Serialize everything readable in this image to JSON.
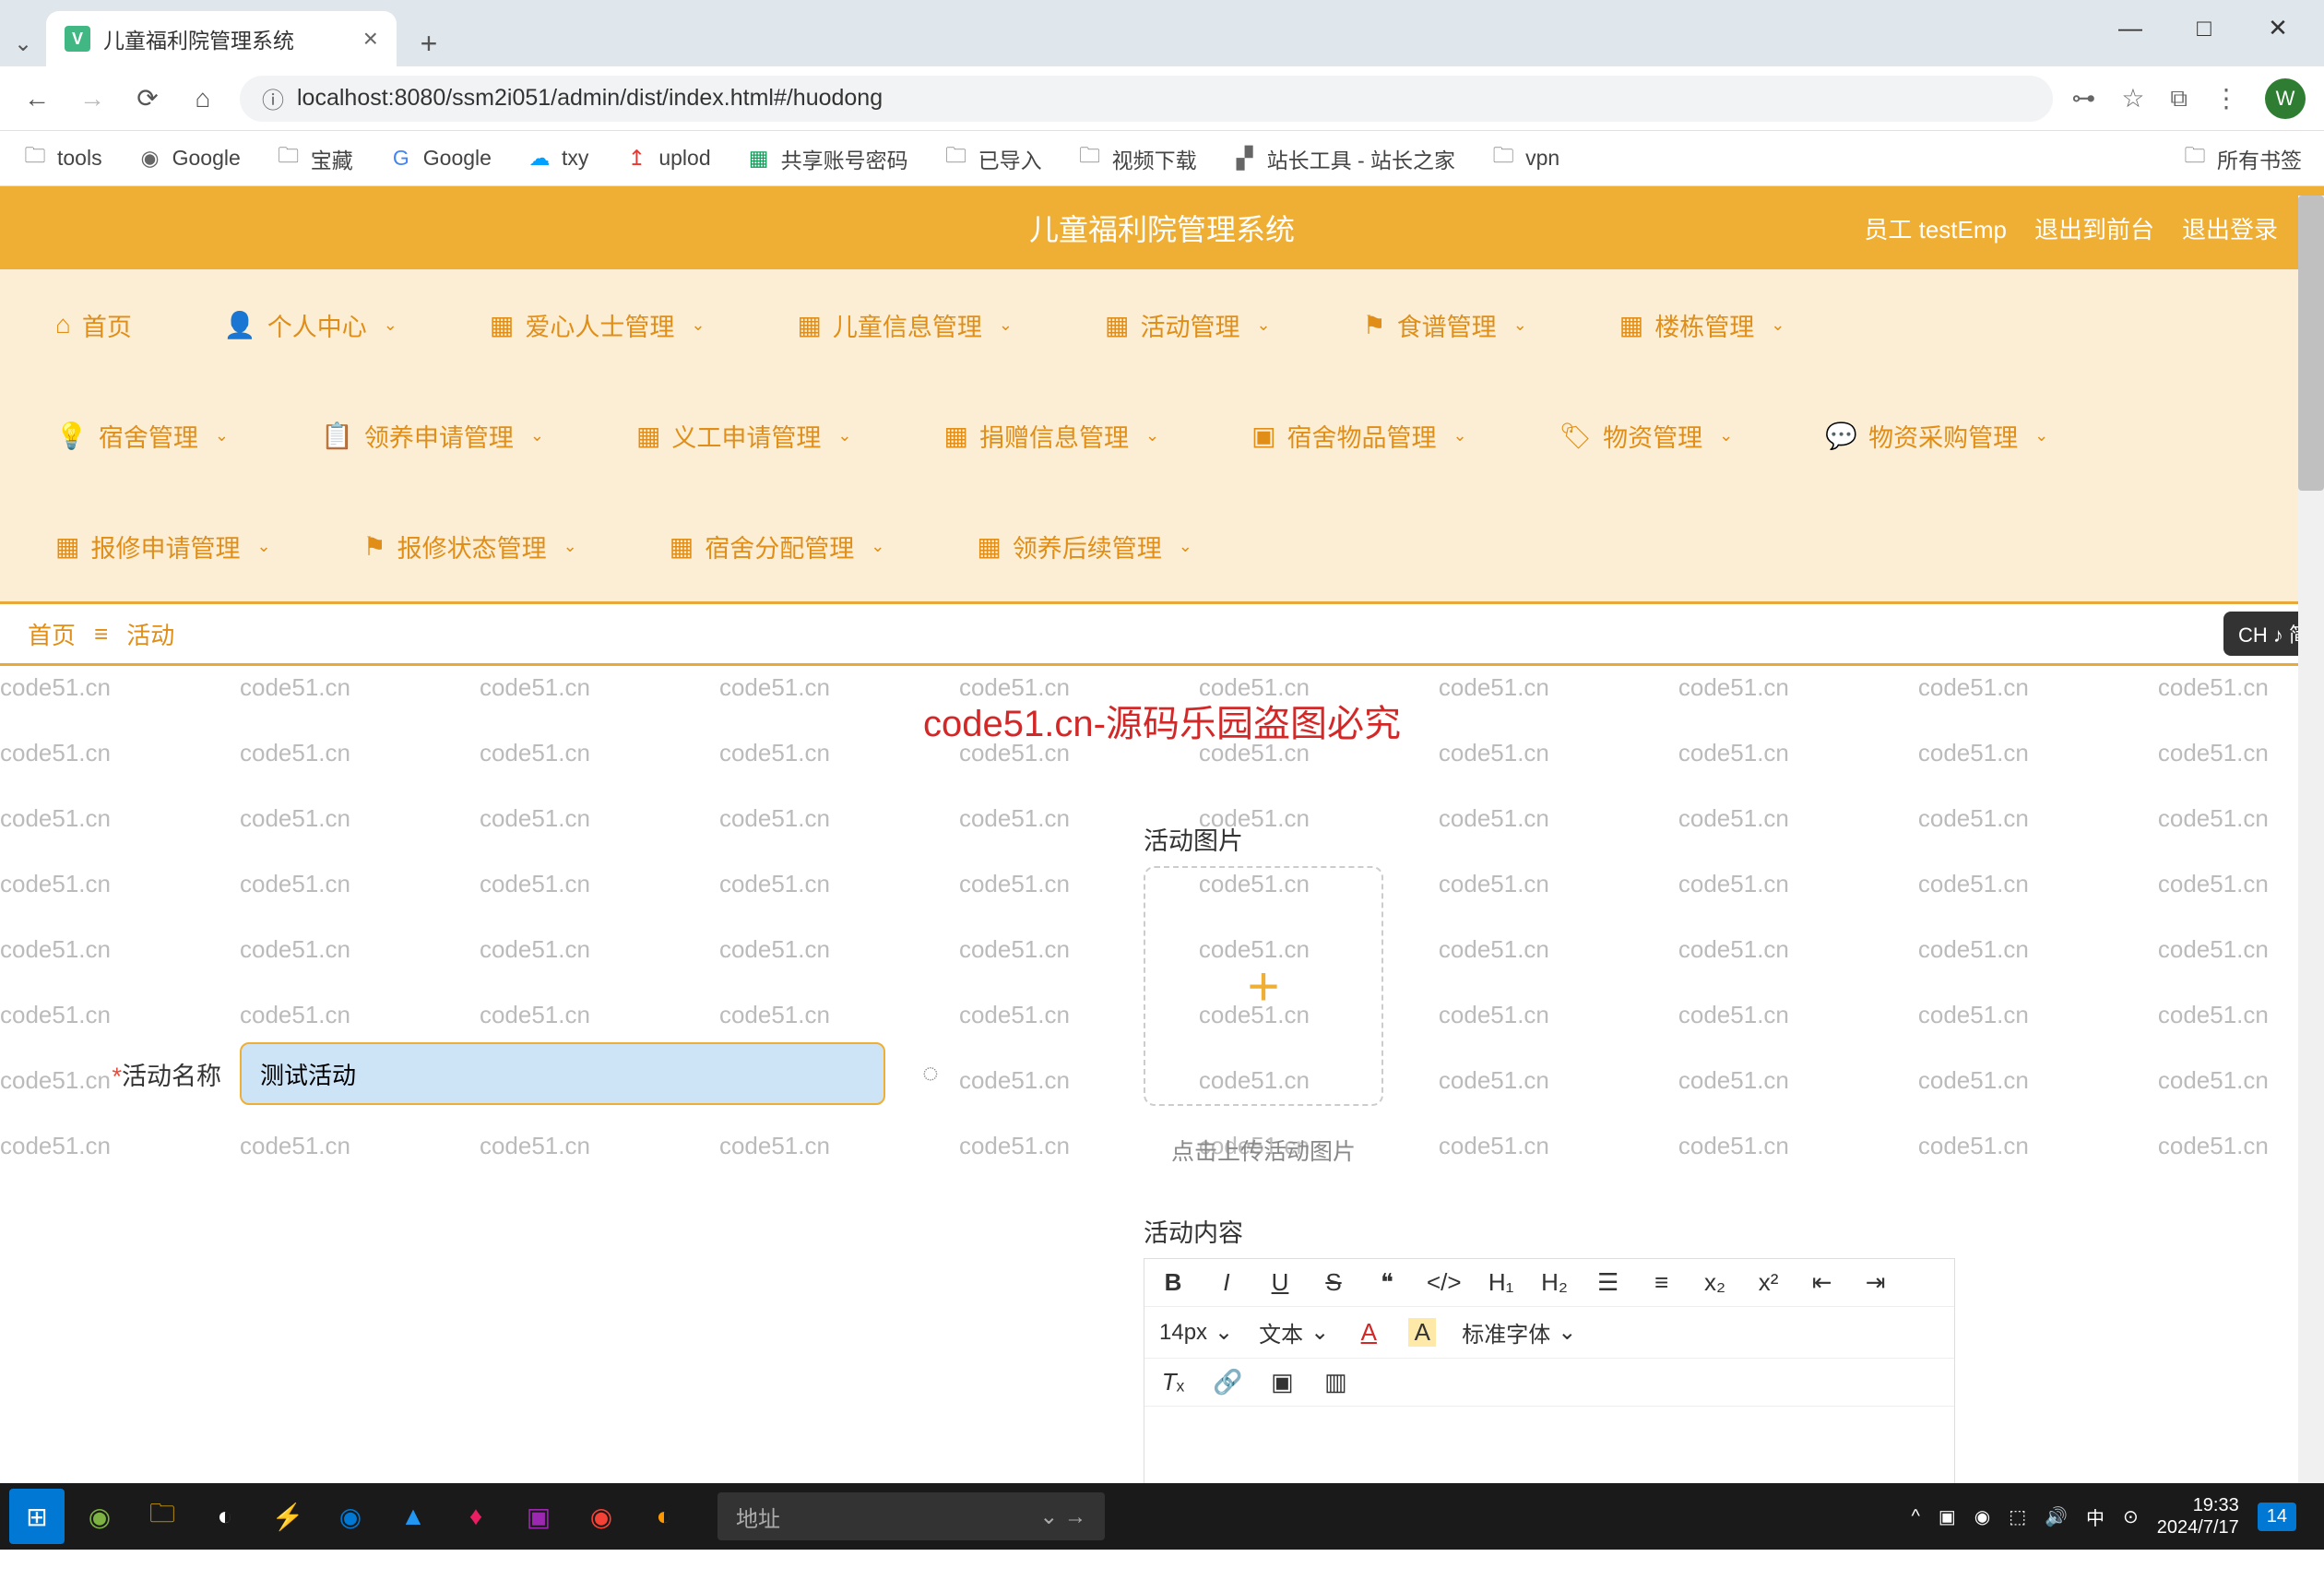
{
  "browser": {
    "tab_title": "儿童福利院管理系统",
    "url": "localhost:8080/ssm2i051/admin/dist/index.html#/huodong",
    "bookmarks": [
      "tools",
      "Google",
      "宝藏",
      "Google",
      "txy",
      "uplod",
      "共享账号密码",
      "已导入",
      "视频下载",
      "站长工具 - 站长之家",
      "vpn"
    ],
    "all_bookmarks": "所有书签"
  },
  "app": {
    "title": "儿童福利院管理系统",
    "user_label": "员工 testEmp",
    "logout_front": "退出到前台",
    "logout": "退出登录"
  },
  "nav": {
    "row1": [
      "首页",
      "个人中心",
      "爱心人士管理",
      "儿童信息管理",
      "活动管理",
      "食谱管理",
      "楼栋管理"
    ],
    "row2": [
      "宿舍管理",
      "领养申请管理",
      "义工申请管理",
      "捐赠信息管理",
      "宿舍物品管理",
      "物资管理",
      "物资采购管理"
    ],
    "row3": [
      "报修申请管理",
      "报修状态管理",
      "宿舍分配管理",
      "领养后续管理"
    ]
  },
  "breadcrumb": {
    "home": "首页",
    "current": "活动"
  },
  "ime": "CH ♪ 简",
  "watermark_big": "code51.cn-源码乐园盗图必究",
  "watermark_repeat": "code51.cn",
  "form": {
    "name_label": "活动名称",
    "name_value": "测试活动",
    "image_label": "活动图片",
    "upload_hint": "点击上传活动图片",
    "content_label": "活动内容"
  },
  "editor": {
    "font_size": "14px",
    "text_type": "文本",
    "font_family": "标准字体"
  },
  "taskbar": {
    "search_placeholder": "地址",
    "time": "19:33",
    "date": "2024/7/17",
    "badge": "14"
  }
}
